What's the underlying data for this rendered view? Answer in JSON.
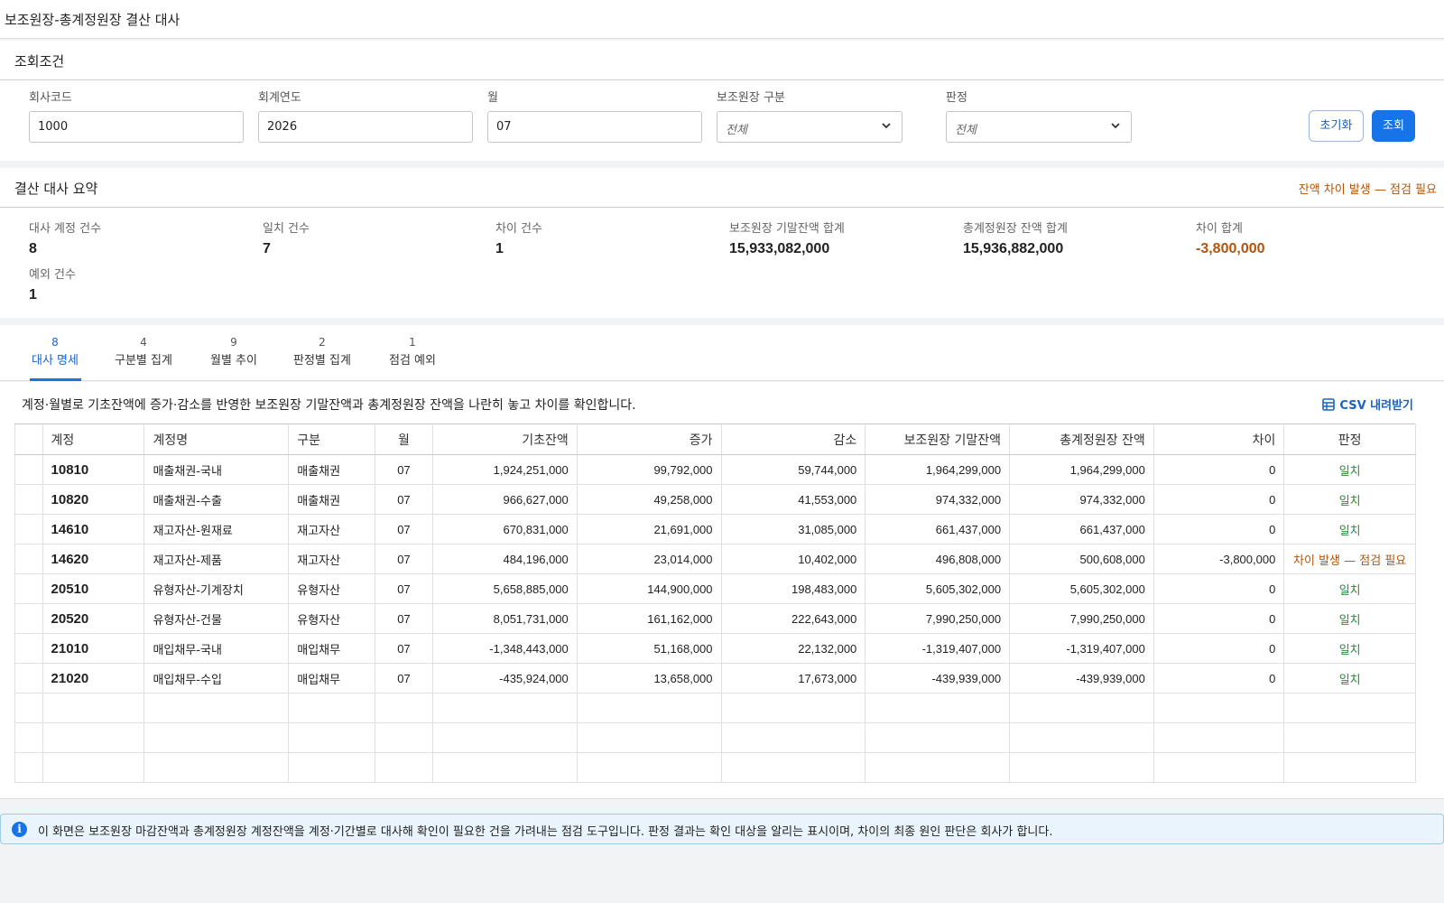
{
  "window": {
    "title": "보조원장-총계정원장 결산 대사"
  },
  "search": {
    "title": "조회조건",
    "fields": [
      {
        "label": "회사코드",
        "value": "1000"
      },
      {
        "label": "회계연도",
        "value": "2026"
      },
      {
        "label": "월",
        "value": "07"
      },
      {
        "label": "보조원장 구분",
        "value": "전체"
      },
      {
        "label": "판정",
        "value": "전체"
      }
    ],
    "reset_label": "초기화",
    "query_label": "조회"
  },
  "summary": {
    "title": "결산 대사 요약",
    "alert": "잔액 차이 발생 — 점검 필요",
    "stats": [
      {
        "label": "대사 계정 건수",
        "value": "8"
      },
      {
        "label": "일치 건수",
        "value": "7"
      },
      {
        "label": "차이 건수",
        "value": "1"
      },
      {
        "label": "보조원장 기말잔액 합계",
        "value": "15,933,082,000"
      },
      {
        "label": "총계정원장 잔액 합계",
        "value": "15,936,882,000"
      },
      {
        "label": "차이 합계",
        "value": "-3,800,000"
      },
      {
        "label": "예외 건수",
        "value": "1"
      }
    ]
  },
  "tabs": [
    {
      "count": "8",
      "label": "대사 명세"
    },
    {
      "count": "4",
      "label": "구분별 집계"
    },
    {
      "count": "9",
      "label": "월별 추이"
    },
    {
      "count": "2",
      "label": "판정별 집계"
    },
    {
      "count": "1",
      "label": "점검 예외"
    }
  ],
  "grid": {
    "description": "계정·월별로 기초잔액에 증가·감소를 반영한 보조원장 기말잔액과 총계정원장 잔액을 나란히 놓고 차이를 확인합니다.",
    "csv_label": "CSV 내려받기",
    "columns": [
      "계정",
      "계정명",
      "구분",
      "월",
      "기초잔액",
      "증가",
      "감소",
      "보조원장 기말잔액",
      "총계정원장 잔액",
      "차이",
      "판정"
    ],
    "rows": [
      [
        "10810",
        "매출채권-국내",
        "매출채권",
        "07",
        "1,924,251,000",
        "99,792,000",
        "59,744,000",
        "1,964,299,000",
        "1,964,299,000",
        "0",
        "일치"
      ],
      [
        "10820",
        "매출채권-수출",
        "매출채권",
        "07",
        "966,627,000",
        "49,258,000",
        "41,553,000",
        "974,332,000",
        "974,332,000",
        "0",
        "일치"
      ],
      [
        "14610",
        "재고자산-원재료",
        "재고자산",
        "07",
        "670,831,000",
        "21,691,000",
        "31,085,000",
        "661,437,000",
        "661,437,000",
        "0",
        "일치"
      ],
      [
        "14620",
        "재고자산-제품",
        "재고자산",
        "07",
        "484,196,000",
        "23,014,000",
        "10,402,000",
        "496,808,000",
        "500,608,000",
        "-3,800,000",
        "차이 발생 — 점검 필요"
      ],
      [
        "20510",
        "유형자산-기계장치",
        "유형자산",
        "07",
        "5,658,885,000",
        "144,900,000",
        "198,483,000",
        "5,605,302,000",
        "5,605,302,000",
        "0",
        "일치"
      ],
      [
        "20520",
        "유형자산-건물",
        "유형자산",
        "07",
        "8,051,731,000",
        "161,162,000",
        "222,643,000",
        "7,990,250,000",
        "7,990,250,000",
        "0",
        "일치"
      ],
      [
        "21010",
        "매입채무-국내",
        "매입채무",
        "07",
        "-1,348,443,000",
        "51,168,000",
        "22,132,000",
        "-1,319,407,000",
        "-1,319,407,000",
        "0",
        "일치"
      ],
      [
        "21020",
        "매입채무-수입",
        "매입채무",
        "07",
        "-435,924,000",
        "13,658,000",
        "17,673,000",
        "-439,939,000",
        "-439,939,000",
        "0",
        "일치"
      ]
    ]
  },
  "notice": {
    "icon": "info-icon",
    "text": "이 화면은 보조원장 마감잔액과 총계정원장 계정잔액을 계정·기간별로 대사해 확인이 필요한 건을 가려내는 점검 도구입니다. 판정 결과는 확인 대상을 알리는 표시이며, 차이의 최종 원인 판단은 회사가 합니다."
  },
  "colors": {
    "accent": "#1773e8",
    "warning": "#b3540a",
    "match": "#2e8b3a"
  }
}
